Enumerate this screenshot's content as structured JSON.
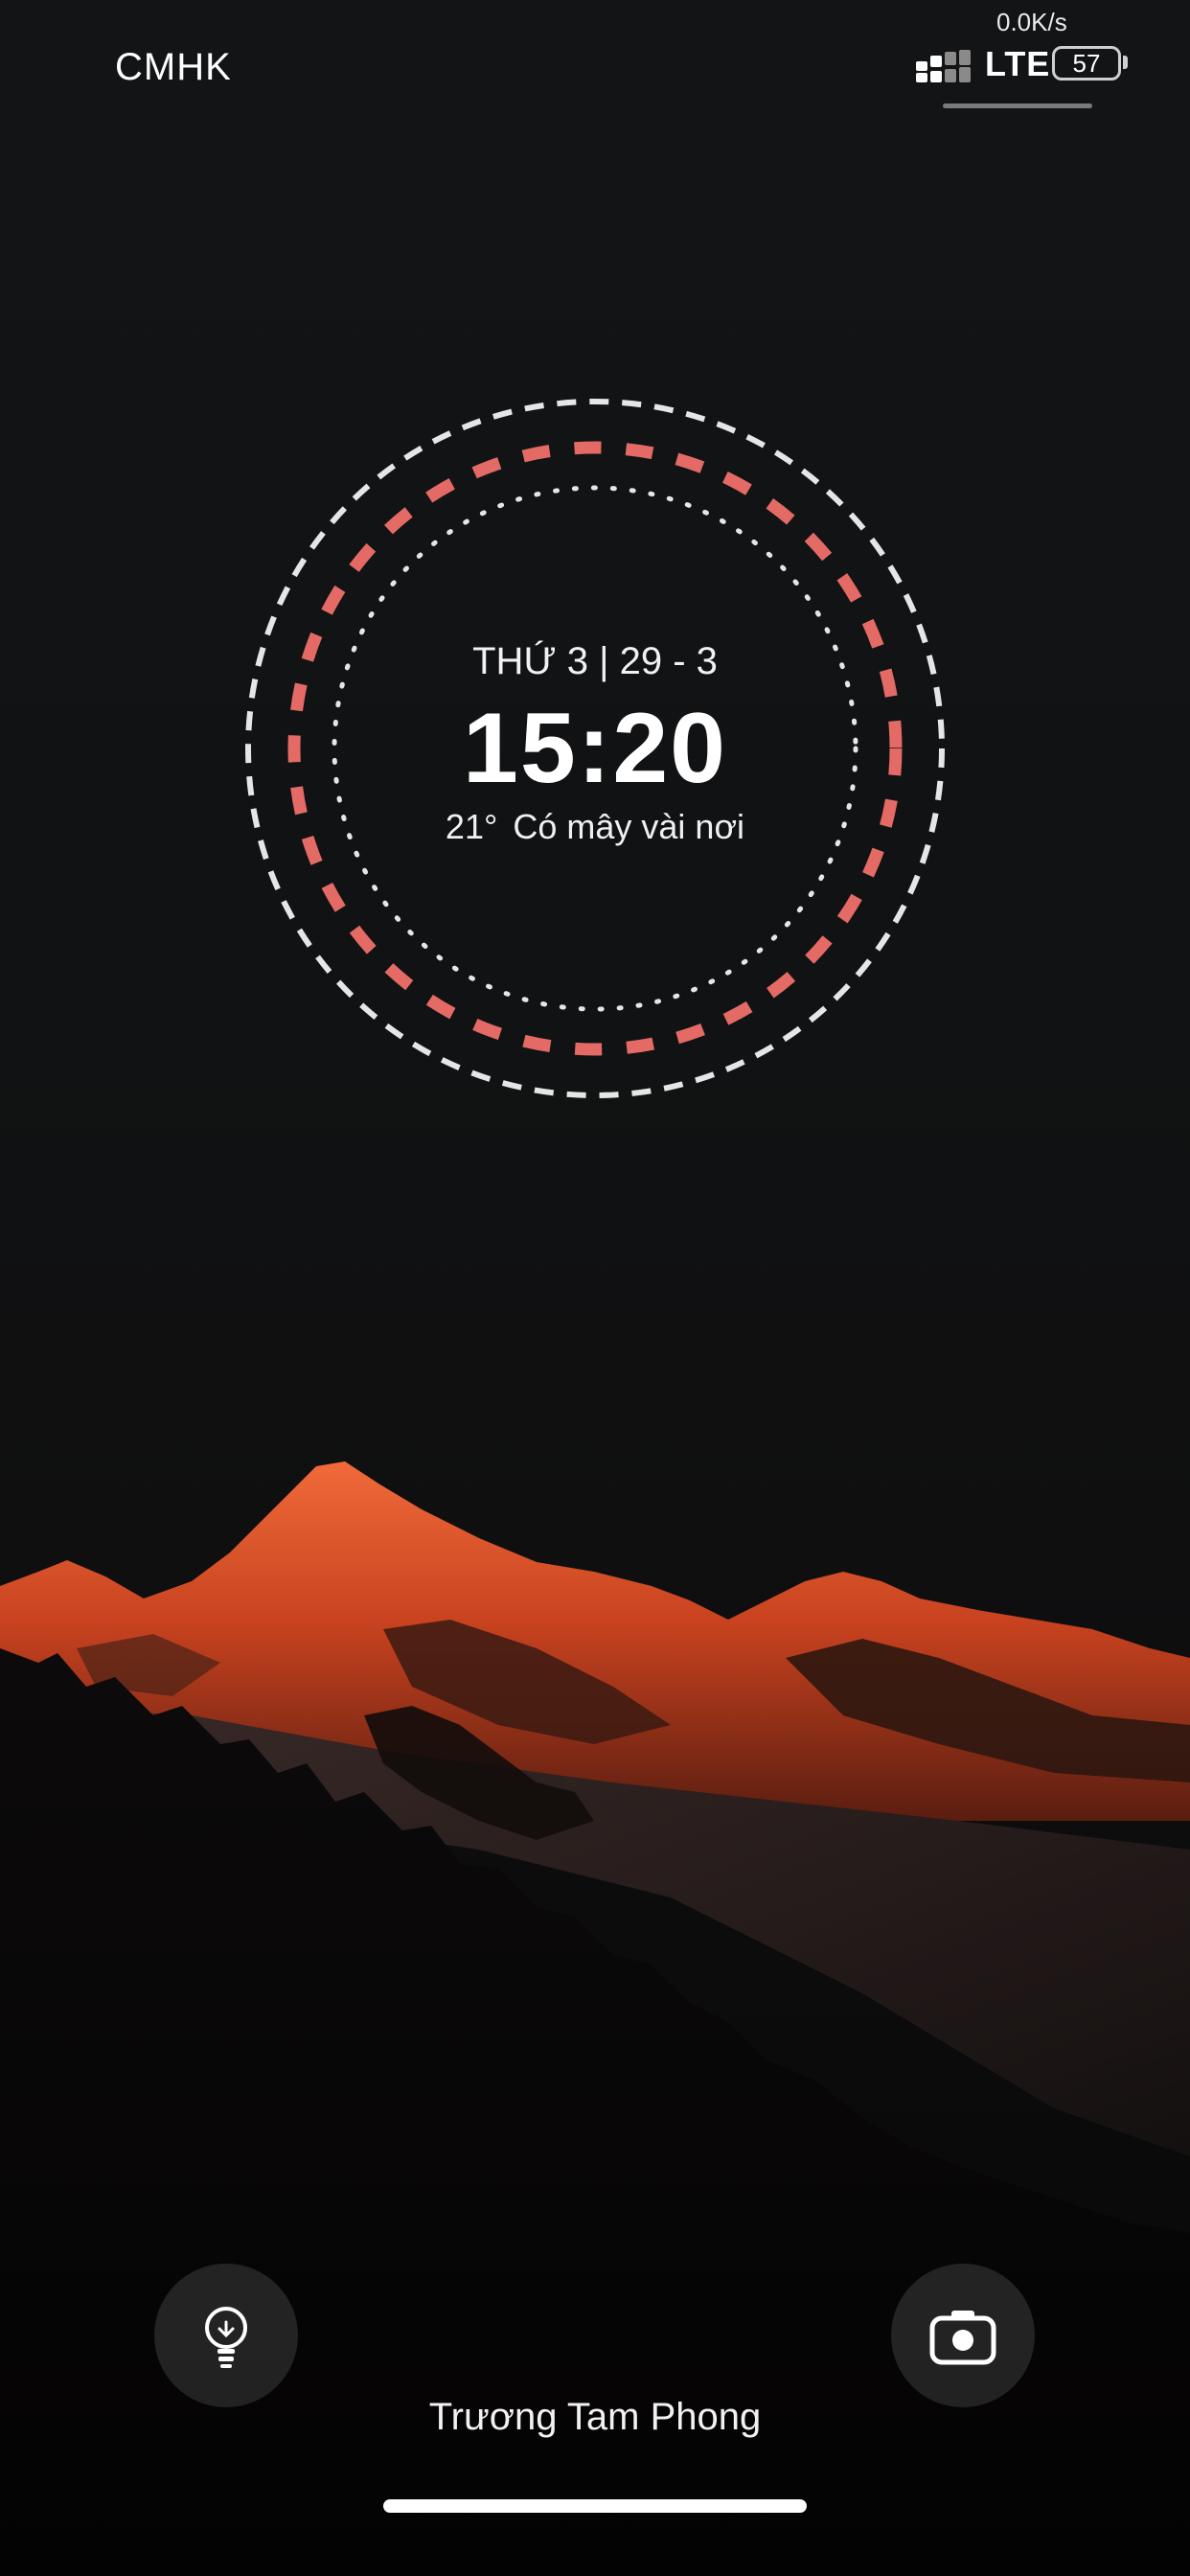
{
  "status_bar": {
    "carrier": "CMHK",
    "net_speed": "0.0K/s",
    "network_type": "LTE",
    "battery_level": "57",
    "signal_icon": "signal-bars-icon"
  },
  "clock_widget": {
    "date_line": "THỨ 3  |  29 - 3",
    "time": "15:20",
    "temperature": "21°",
    "condition": "Có mây vài nơi",
    "colors": {
      "outer_ring": "#e6e6e6",
      "middle_ring": "#e46a66",
      "inner_ring": "#e6e6e6"
    }
  },
  "bottom": {
    "flashlight_icon": "flashlight-icon",
    "camera_icon": "camera-icon",
    "owner_name": "Trương Tam Phong"
  },
  "wallpaper": {
    "description_colors": {
      "sky": "#121416",
      "mountain_glow": "#e0552a",
      "foreground": "#050404"
    }
  }
}
